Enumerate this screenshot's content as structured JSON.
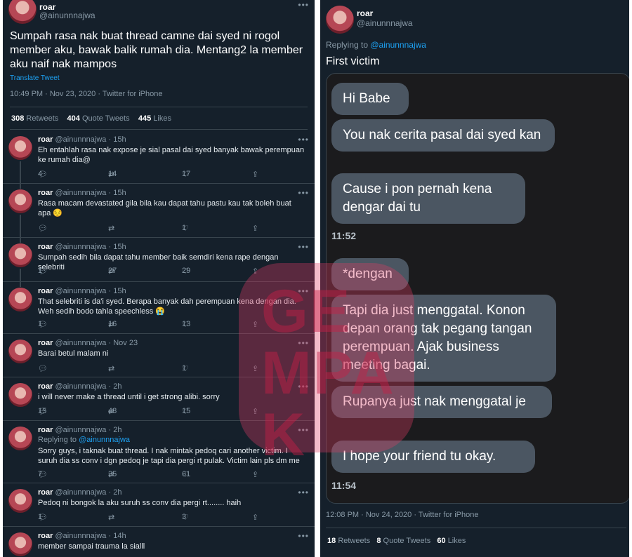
{
  "left": {
    "author": {
      "name": "roar",
      "handle": "@ainunnnajwa"
    },
    "tweet_text": "Sumpah rasa nak buat thread camne dai syed ni rogol member aku, bawak balik rumah dia. Mentang2 la member aku naif nak mampos",
    "translate": "Translate Tweet",
    "timestamp": "10:49 PM · Nov 23, 2020 · Twitter for iPhone",
    "stats": {
      "retweets_n": "308",
      "retweets_l": "Retweets",
      "quotes_n": "404",
      "quotes_l": "Quote Tweets",
      "likes_n": "445",
      "likes_l": "Likes"
    },
    "replies": [
      {
        "name": "roar",
        "handle": "@ainunnnajwa",
        "time": "15h",
        "text": "Eh entahlah rasa nak expose je sial pasal dai syed banyak bawak perempuan ke rumah dia@",
        "replies": "4",
        "retweets": "14",
        "likes": "17"
      },
      {
        "name": "roar",
        "handle": "@ainunnnajwa",
        "time": "15h",
        "text": "Rasa macam devastated gila bila kau dapat tahu pastu kau tak boleh buat apa 😔",
        "replies": "",
        "retweets": "",
        "likes": "1"
      },
      {
        "name": "roar",
        "handle": "@ainunnnajwa",
        "time": "15h",
        "text": "Sumpah sedih bila dapat tahu member baik semdiri kena rape dengan selebriti",
        "replies": "1",
        "retweets": "27",
        "likes": "29"
      },
      {
        "name": "roar",
        "handle": "@ainunnnajwa",
        "time": "15h",
        "text": "That selebriti is da'i syed. Berapa banyak dah perempuan kena dengan dia. Weh sedih bodo tahla speechless 😭",
        "replies": "1",
        "retweets": "16",
        "likes": "13"
      },
      {
        "name": "roar",
        "handle": "@ainunnnajwa",
        "time": "Nov 23",
        "text": "Barai betul malam ni",
        "replies": "",
        "retweets": "",
        "likes": "1"
      },
      {
        "name": "roar",
        "handle": "@ainunnnajwa",
        "time": "2h",
        "text": "i will never make a thread until i get strong alibi. sorry",
        "replies": "15",
        "retweets": "48",
        "likes": "15"
      },
      {
        "name": "roar",
        "handle": "@ainunnnajwa",
        "time": "2h",
        "replying_prefix": "Replying to ",
        "replying_handle": "@ainunnnajwa",
        "text": "Sorry guys, i taknak buat thread. I nak mintak pedoq cari another victim. I suruh dia ss conv i dgn pedoq je tapi dia pergi rt pulak. Victim lain pls dm me",
        "replies": "7",
        "retweets": "35",
        "likes": "61"
      },
      {
        "name": "roar",
        "handle": "@ainunnnajwa",
        "time": "2h",
        "text": "Pedoq ni bongok la aku suruh ss conv dia pergi rt........ haih",
        "replies": "1",
        "retweets": "",
        "likes": "3"
      },
      {
        "name": "roar",
        "handle": "@ainunnnajwa",
        "time": "14h",
        "text": "member sampai trauma la sialll",
        "replies": "",
        "retweets": "",
        "likes": ""
      }
    ]
  },
  "right": {
    "author": {
      "name": "roar",
      "handle": "@ainunnnajwa"
    },
    "replying_prefix": "Replying to ",
    "replying_handle": "@ainunnnajwa",
    "tweet_text": "First victim",
    "messages": [
      "Hi Babe",
      "You nak cerita pasal dai syed kan",
      "Cause i pon pernah kena dengar dai tu",
      "*dengan",
      "Tapi dia just menggatal. Konon depan orang tak pegang tangan perempuan. Ajak business meeting bagai.",
      "Rupanya just nak menggatal je",
      "I hope your friend tu okay."
    ],
    "time1": "11:52",
    "time2": "11:54",
    "timestamp": "12:08 PM · Nov 24, 2020 · Twitter for iPhone",
    "stats": {
      "retweets_n": "18",
      "retweets_l": "Retweets",
      "quotes_n": "8",
      "quotes_l": "Quote Tweets",
      "likes_n": "60",
      "likes_l": "Likes"
    }
  },
  "watermark": "GEMPAK",
  "icons": {
    "reply": "speech-bubble",
    "retweet": "retweet-arrows",
    "like": "heart",
    "share": "share-arrow",
    "more": "ellipsis"
  },
  "colors": {
    "background": "#15202b",
    "link": "#1da1f2",
    "bubble": "#4b5662"
  }
}
